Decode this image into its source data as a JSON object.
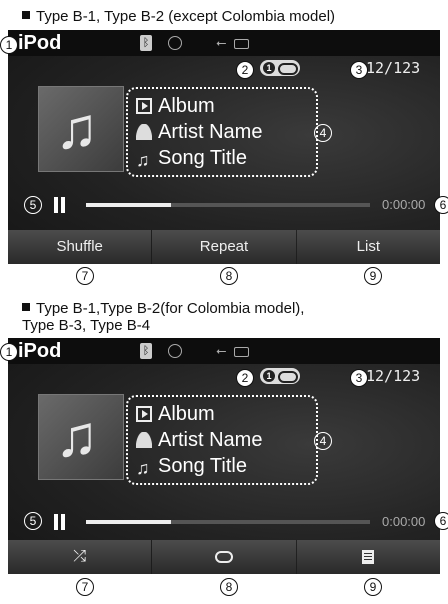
{
  "captions": {
    "top": "Type B-1, Type B-2 (except Colombia model)",
    "bottom_line1": "Type B-1,Type B-2(for Colombia model),",
    "bottom_line2": "Type B-3, Type B-4"
  },
  "screen": {
    "mode": "iPod",
    "track_count": "12/123",
    "album": "Album",
    "artist": "Artist Name",
    "song": "Song Title",
    "time": "0:00:00",
    "progress_fraction": 0.3,
    "repeat_one": "1"
  },
  "buttons_text": {
    "shuffle": "Shuffle",
    "repeat": "Repeat",
    "list": "List"
  },
  "icons": [
    "bluetooth-icon",
    "disc-icon",
    "usb-icon",
    "battery-icon",
    "album-icon",
    "artist-icon",
    "song-icon",
    "pause-icon",
    "shuffle-icon",
    "repeat-icon",
    "list-icon",
    "album-art-note-icon"
  ],
  "callouts": {
    "n1": "1",
    "n2": "2",
    "n3": "3",
    "n4": "4",
    "n5": "5",
    "n6": "6",
    "n7": "7",
    "n8": "8",
    "n9": "9"
  }
}
